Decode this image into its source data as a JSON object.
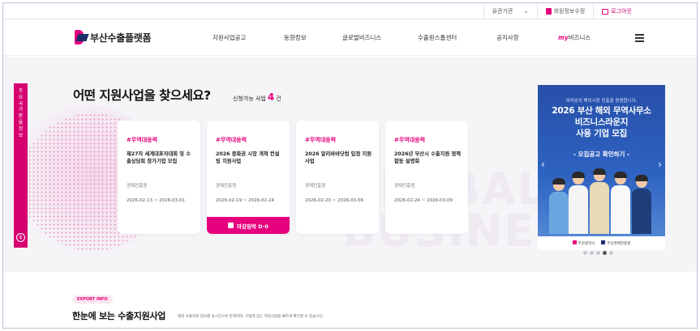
{
  "util": {
    "select_label": "유관기관",
    "join_label": "회원정보수정",
    "logout_label": "로그아웃"
  },
  "header": {
    "logo_text": "부산수출플랫폼",
    "nav": [
      "지원사업공고",
      "동향정보",
      "글로벌비즈니스",
      "수출원스톱센터",
      "공지사항"
    ],
    "my_prefix": "my",
    "my_label": "비즈니스"
  },
  "hero": {
    "side_tab_text": "주요국가환율정보",
    "title": "어떤 지원사업을 찾으세요?",
    "count_prefix": "신청가능 사업",
    "count_num": "4",
    "count_suffix": "건",
    "watermark_line1": "GLOBAL",
    "watermark_line2": "BUSINESS",
    "cards": [
      {
        "tag": "#무역대응력",
        "title": "제27차 세계대표자대회 및 수출상담회 참가기업 모집",
        "org": "경제진흥원",
        "date": "2026-02-13 ~ 2026-03-01",
        "deadline": ""
      },
      {
        "tag": "#무역대응력",
        "title": "2026 중화권 시장 개척 컨설팅 지원사업",
        "org": "경제진흥원",
        "date": "2026-02-19 ~ 2026-02-24",
        "deadline": "마감임박 D-0"
      },
      {
        "tag": "#무역대응력",
        "title": "2026 알리바바닷컴 입점 지원사업",
        "org": "경제진흥원",
        "date": "2026-02-20 ~ 2026-03-06",
        "deadline": ""
      },
      {
        "tag": "#무역대응력",
        "title": "2026년 부산시 수출지원 정책 합동 설명회",
        "org": "경제진흥원",
        "date": "2026-02-24 ~ 2026-03-09",
        "deadline": ""
      }
    ]
  },
  "banner": {
    "small_text": "여러분의 해외시장 진출을 응원합니다.",
    "title_line1": "2026 부산 해외 무역사무소",
    "title_line2": "비즈니스라운지",
    "title_line3": "사용 기업 모집",
    "sub": "- 모집공고 확인하기 -",
    "footer_left": "부산광역시",
    "footer_right": "부산경제진흥원",
    "pages": 5,
    "active_page": 4
  },
  "section": {
    "pill": "EXPORT INFO",
    "title": "한눈에 보는 수출지원사업",
    "desc": "해외 수출지원 정보를 실시간으로 연계하여, 기업에 맞는 지원사업을 빠르게 확인할 수 있습니다."
  },
  "colors": {
    "accent": "#e6007e",
    "navy": "#1c2f6b",
    "banner_blue": "#2e63c2"
  }
}
